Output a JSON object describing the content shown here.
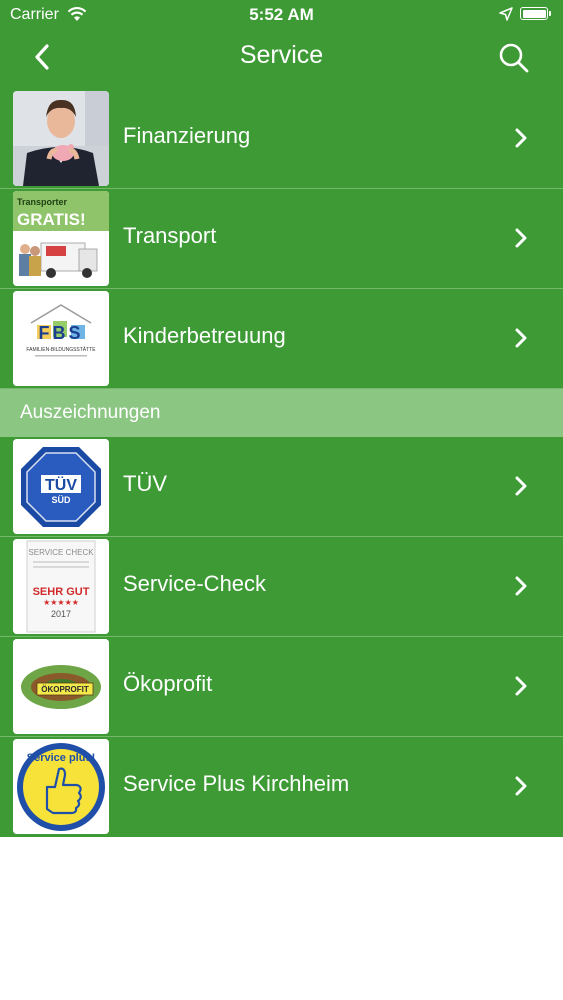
{
  "status_bar": {
    "carrier": "Carrier",
    "time": "5:52 AM",
    "battery": 1.0
  },
  "nav": {
    "title": "Service",
    "back_icon": "chevron-left-icon",
    "search_icon": "search-icon"
  },
  "sections": [
    {
      "header": "",
      "items": [
        {
          "label": "Finanzierung",
          "icon": "finanzierung-thumbnail"
        },
        {
          "label": "Transport",
          "icon": "transport-thumbnail",
          "image_text": [
            "Transporter",
            "GRATIS!"
          ]
        },
        {
          "label": "Kinderbetreuung",
          "icon": "fbs-logo-thumbnail",
          "image_text": [
            "FBS",
            "FAMILIEN-BILDUNGSSTÄTTE"
          ]
        }
      ]
    },
    {
      "header": "Auszeichnungen",
      "items": [
        {
          "label": "TÜV",
          "icon": "tuev-sued-logo",
          "image_text": [
            "TÜV",
            "SÜD"
          ]
        },
        {
          "label": "Service-Check",
          "icon": "service-check-seal",
          "image_text": [
            "SERVICE CHECK",
            "SEHR GUT",
            "★★★★★",
            "2017"
          ]
        },
        {
          "label": "Ökoprofit",
          "icon": "oekoprofit-logo",
          "image_text": [
            "ÖKOPROFIT"
          ]
        },
        {
          "label": "Service Plus Kirchheim",
          "icon": "service-plus-badge",
          "image_text": [
            "Service plus!"
          ]
        }
      ]
    }
  ],
  "colors": {
    "bar": "#3d9a35",
    "section_header": "#8cc683",
    "text": "#ffffff",
    "background": "#ffffff"
  }
}
